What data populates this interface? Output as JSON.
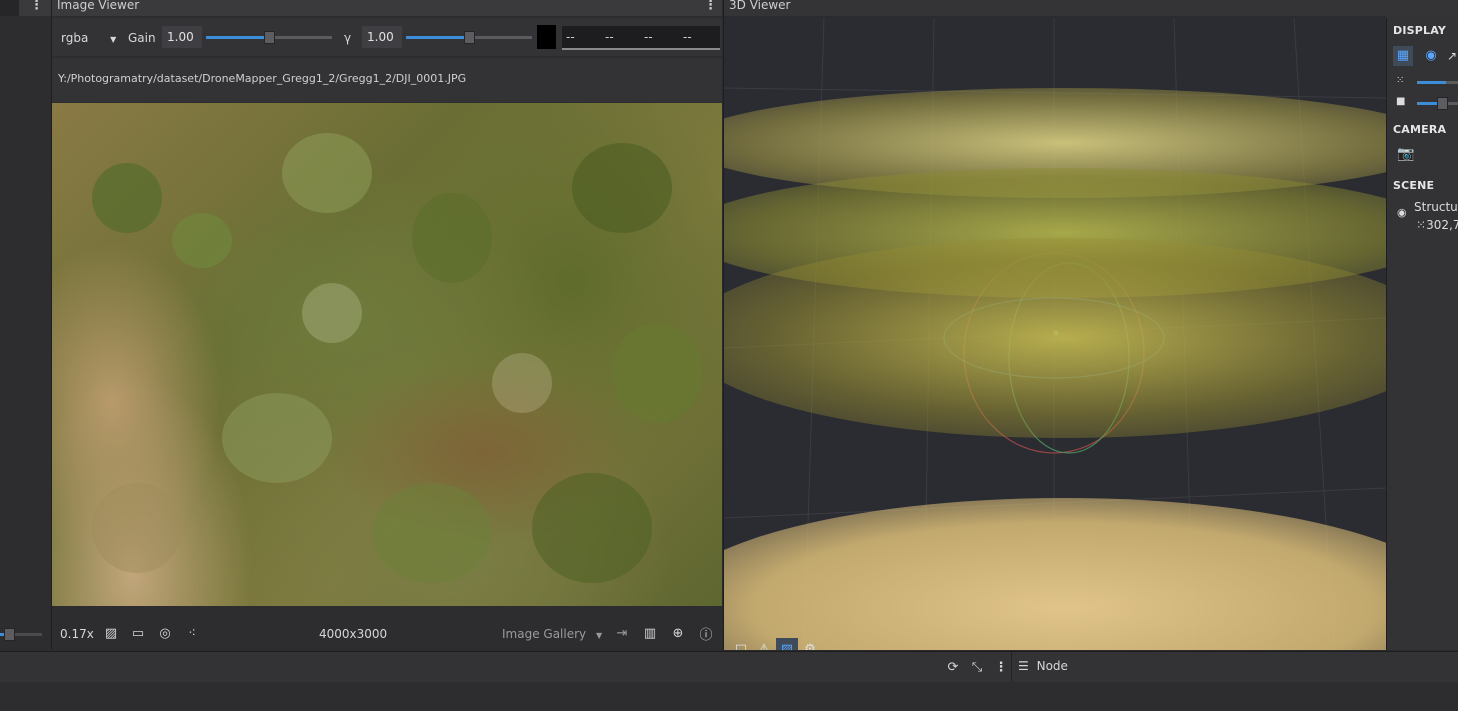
{
  "image_viewer": {
    "title": "Image Viewer",
    "menu_icon": "more-vertical-icon",
    "toolbar": {
      "channel_mode": "rgba",
      "gain_label": "Gain",
      "gain_value": "1.00",
      "gain_level": 0.5,
      "gamma_label": "γ",
      "gamma_value": "1.00",
      "gamma_level": 0.5,
      "color_channels": [
        "--",
        "--",
        "--",
        "--"
      ]
    },
    "image_path": "Y:/Photogramatry/dataset/DroneMapper_Gregg1_2/Gregg1_2/DJI_0001.JPG",
    "status": {
      "zoom": "0.17x",
      "resolution": "4000x3000",
      "gallery_label": "Image Gallery"
    }
  },
  "viewer_3d": {
    "title": "3D Viewer",
    "display_label": "DISPLAY",
    "camera_label": "CAMERA",
    "scene_label": "SCENE",
    "scene_item_name": "Structur",
    "scene_item_count": "302,7",
    "point_size_level": 0.7,
    "camera_scale_level": 0.6
  },
  "bottom": {
    "node_label": "Node"
  },
  "colors": {
    "accent": "#3c8ed8",
    "panel_bg": "#333336",
    "canvas_bg": "#2b2c31"
  }
}
